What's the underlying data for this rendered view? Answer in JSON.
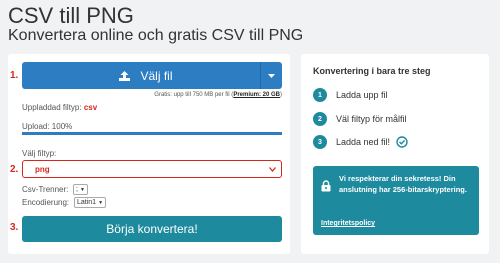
{
  "header": {
    "title": "CSV till PNG",
    "subtitle": "Konvertera online och gratis CSV till PNG"
  },
  "converter": {
    "step1_num": "1.",
    "step2_num": "2.",
    "step3_num": "3.",
    "choose_file_label": "Välj fil",
    "free_note_prefix": "Gratis: upp till 750 MB per fil (",
    "premium_label": "Premium: 20 GB",
    "free_note_suffix": ")",
    "uploaded_type_label": "Uppladdad filtyp:",
    "uploaded_type_value": "csv",
    "upload_status": "Upload: 100%",
    "upload_progress": 1.0,
    "choose_type_label": "Välj filtyp:",
    "selected_format": "png",
    "csv_separator_label": "Csv-Trenner:",
    "csv_separator_value": ";",
    "encoding_label": "Encodierung:",
    "encoding_value": "Latin1",
    "convert_button": "Börja konvertera!"
  },
  "steps_panel": {
    "title": "Konvertering i bara tre steg",
    "steps": [
      {
        "num": "1",
        "text": "Ladda upp fil"
      },
      {
        "num": "2",
        "text": "Väl filtyp för målfil"
      },
      {
        "num": "3",
        "text": "Ladda ned fil!"
      }
    ],
    "privacy_text": "Vi respekterar din sekretess! Din anslutning har 256-bitarskryptering.",
    "privacy_link": "Integritetspolicy"
  },
  "colors": {
    "primary_blue": "#2d7dc3",
    "teal": "#1e8a9e",
    "accent_red": "#d8261c"
  }
}
